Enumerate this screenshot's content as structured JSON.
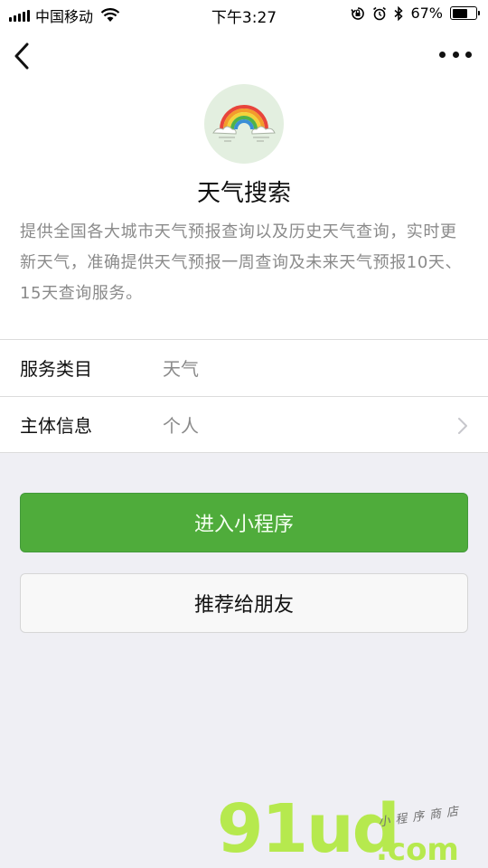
{
  "status_bar": {
    "carrier": "中国移动",
    "time": "下午3:27",
    "battery": "67%",
    "battery_level": 0.67
  },
  "nav": {
    "back_icon": "chevron-left-icon",
    "more_icon": "more-dots-icon"
  },
  "app": {
    "logo_icon": "rainbow-icon",
    "name": "天气搜索",
    "description": "提供全国各大城市天气预报查询以及历史天气查询，实时更新天气，准确提供天气预报一周查询及未来天气预报10天、15天查询服务。"
  },
  "info_rows": [
    {
      "label": "服务类目",
      "value": "天气"
    },
    {
      "label": "主体信息",
      "value": "个人"
    }
  ],
  "buttons": {
    "enter": "进入小程序",
    "recommend": "推荐给朋友"
  },
  "watermark": {
    "brand": "91ud",
    "domain": ".com",
    "slogan": "小程序商店"
  },
  "colors": {
    "primary_green": "#4fac3b",
    "watermark_green": "#b6e94e"
  }
}
